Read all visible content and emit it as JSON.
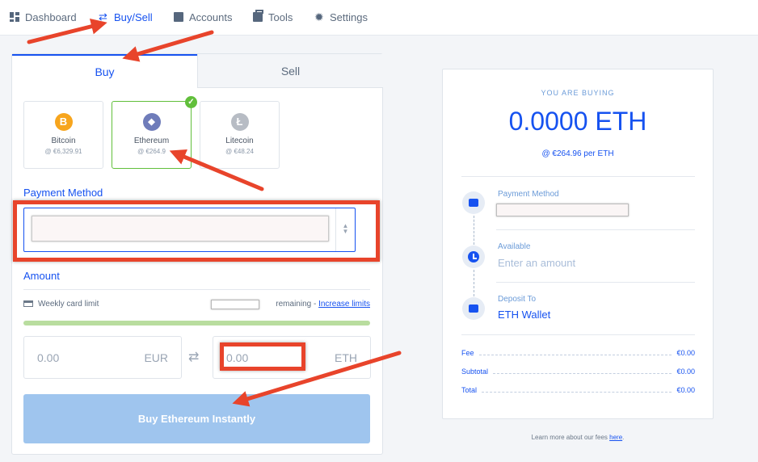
{
  "nav": {
    "items": [
      {
        "label": "Dashboard",
        "icon": "dashboard-icon"
      },
      {
        "label": "Buy/Sell",
        "icon": "swap-icon",
        "active": true
      },
      {
        "label": "Accounts",
        "icon": "wallet-icon"
      },
      {
        "label": "Tools",
        "icon": "toolbox-icon"
      },
      {
        "label": "Settings",
        "icon": "gear-icon"
      }
    ]
  },
  "tabs": {
    "buy": "Buy",
    "sell": "Sell"
  },
  "coins": [
    {
      "name": "Bitcoin",
      "price": "@ €6,329.91",
      "symbol": "B",
      "color": "#f7a51d"
    },
    {
      "name": "Ethereum",
      "price": "@ €264.9",
      "symbol": "◆",
      "color": "#6f7cba",
      "selected": true
    },
    {
      "name": "Litecoin",
      "price": "@ €48.24",
      "symbol": "Ł",
      "color": "#b7bcc4"
    }
  ],
  "payment_method": {
    "label": "Payment Method"
  },
  "amount": {
    "label": "Amount",
    "weekly_limit": "Weekly card limit",
    "remaining": "remaining - ",
    "increase_link": "Increase limits",
    "limit_progress": 1.0,
    "eur_value": "0.00",
    "eur_currency": "EUR",
    "eth_value": "0.00",
    "eth_currency": "ETH"
  },
  "buy_button": "Buy Ethereum Instantly",
  "summary": {
    "heading": "YOU ARE BUYING",
    "amount": "0.0000 ETH",
    "rate": "@ €264.96 per ETH",
    "payment_label": "Payment Method",
    "available_label": "Available",
    "available_value": "Enter an amount",
    "deposit_label": "Deposit To",
    "deposit_value": "ETH Wallet",
    "fee_label": "Fee",
    "fee_value": "€0.00",
    "subtotal_label": "Subtotal",
    "subtotal_value": "€0.00",
    "total_label": "Total",
    "total_value": "€0.00"
  },
  "footer": {
    "text": "Learn more about our fees ",
    "link": "here",
    "period": "."
  },
  "colors": {
    "accent": "#1652f0",
    "annotation": "#e8442b",
    "success": "#61bf3b"
  }
}
